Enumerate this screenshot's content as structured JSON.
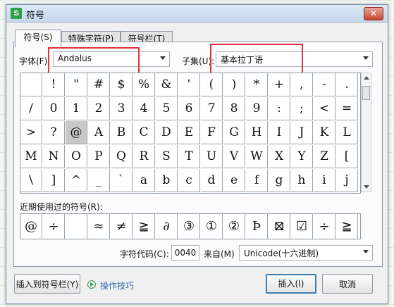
{
  "window": {
    "title": "符号",
    "app_icon_letter": "S",
    "close_label": "✕"
  },
  "tabs": [
    {
      "label": "符号(S)",
      "active": true
    },
    {
      "label": "特殊字符(P)",
      "active": false
    },
    {
      "label": "符号栏(T)",
      "active": false
    }
  ],
  "font": {
    "label": "字体(F):",
    "value": "Andalus"
  },
  "subset": {
    "label": "子集(U):",
    "value": "基本拉丁语"
  },
  "symbol_grid": {
    "rows": [
      [
        "",
        "!",
        "\"",
        "#",
        "$",
        "%",
        "&",
        "'",
        "(",
        ")",
        "*",
        "+",
        ",",
        "-",
        "."
      ],
      [
        "/",
        "0",
        "1",
        "2",
        "3",
        "4",
        "5",
        "6",
        "7",
        "8",
        "9",
        ":",
        ";",
        "<",
        "="
      ],
      [
        ">",
        "?",
        "@",
        "A",
        "B",
        "C",
        "D",
        "E",
        "F",
        "G",
        "H",
        "I",
        "J",
        "K",
        "L"
      ],
      [
        "M",
        "N",
        "O",
        "P",
        "Q",
        "R",
        "S",
        "T",
        "U",
        "V",
        "W",
        "X",
        "Y",
        "Z",
        "["
      ],
      [
        "\\",
        "]",
        "^",
        "_",
        "`",
        "a",
        "b",
        "c",
        "d",
        "e",
        "f",
        "g",
        "h",
        "i",
        "j"
      ]
    ],
    "selected": "@"
  },
  "recent": {
    "label": "近期使用过的符号(R):",
    "symbols": [
      "@",
      "÷",
      "",
      "≈",
      "≠",
      "≧",
      "∂",
      "③",
      "①",
      "②",
      "Þ",
      "⊠",
      "☑",
      "÷",
      "≧"
    ]
  },
  "char_code": {
    "label": "字符代码(C):",
    "value": "0040"
  },
  "from": {
    "label": "来自(M)",
    "value": "Unicode(十六进制)"
  },
  "buttons": {
    "insert_to_bar": "插入到符号栏(Y)",
    "tips": "操作技巧",
    "insert": "插入(I)",
    "cancel": "取消"
  },
  "colors": {
    "highlight": "#e0323b",
    "accent": "#3c7fb1",
    "app_icon": "#2fa14d"
  }
}
